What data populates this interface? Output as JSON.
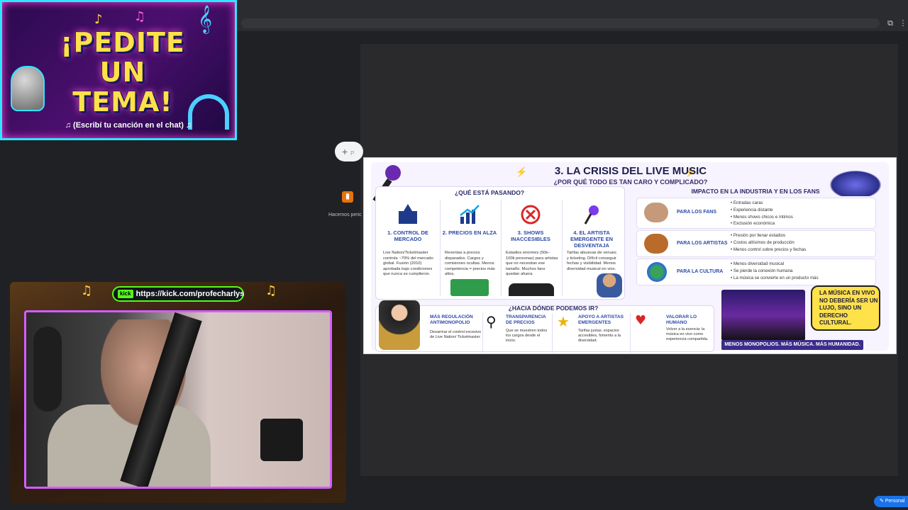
{
  "browser": {
    "extension_label": "Hacemos peric",
    "plus_button": "+",
    "plus_hint": "P",
    "bottom_pill": "Personal"
  },
  "overlay": {
    "title_line1": "¡PEDITE",
    "title_line2": "UN TEMA!",
    "subtitle": "♫ (Escribí tu canción en el chat) ♫"
  },
  "webcam": {
    "kick_logo": "kick",
    "kick_url": "https://kick.com/profecharlys"
  },
  "slide": {
    "title": "3. LA CRISIS DEL LIVE MUSIC",
    "subtitle": "¿POR QUÉ TODO ES TAN CARO Y COMPLICADO?",
    "left_heading": "¿QUÉ ESTÁ PASANDO?",
    "columns": [
      {
        "title": "1. CONTROL DE MERCADO",
        "text": "Live Nation/Ticketmaster controla ~70% del mercado global. Fusión (2010) aprobada bajo condiciones que nunca se cumplieron.",
        "icon": "building-icon"
      },
      {
        "title": "2. PRECIOS EN ALZA",
        "text": "Reventas a precios disparados. Cargos y comisiones ocultas. Menos competencia = precios más altos.",
        "icon": "chart-up-icon"
      },
      {
        "title": "3. SHOWS INACCESIBLES",
        "text": "Estadios enormes (50k–100k personas) para artistas que no necesitan ese tamaño. Muchos fans quedan afuera.",
        "icon": "x-circle-icon"
      },
      {
        "title": "4. EL ARTISTA EMERGENTE EN DESVENTAJA",
        "text": "Tarifas abusivas de venues y ticketing. Difícil conseguir fechas y visibilidad. Menos diversidad musical en vivo.",
        "icon": "microphone-icon"
      }
    ],
    "right_heading": "IMPACTO EN LA INDUSTRIA Y EN LOS FANS",
    "impacts": [
      {
        "label": "PARA LOS FANS",
        "items": [
          "Entradas caras",
          "Experiencia distante",
          "Menos shows chicos e íntimos",
          "Exclusión económica"
        ]
      },
      {
        "label": "PARA LOS ARTISTAS",
        "items": [
          "Presión por llenar estadios",
          "Costos altísimos de producción",
          "Menos control sobre precios y fechas"
        ]
      },
      {
        "label": "PARA LA CULTURA",
        "items": [
          "Menos diversidad musical",
          "Se pierde la conexión humana",
          "La música se convierte en un producto más"
        ]
      }
    ],
    "bottom_heading": "¿HACIA DÓNDE PODEMOS IR?",
    "solutions": [
      {
        "title": "MÁS REGULACIÓN ANTIMONOPOLIO",
        "text": "Desarmar el control excesivo de Live Nation/ Ticketmaster."
      },
      {
        "title": "TRANSPARENCIA DE PRECIOS",
        "text": "Que se muestren todos los cargos desde el inicio."
      },
      {
        "title": "APOYO A ARTISTAS EMERGENTES",
        "text": "Tarifas justas, espacios accesibles, fomento a la diversidad."
      },
      {
        "title": "VALORAR LO HUMANO",
        "text": "Volver a la esencia: la música en vivo como experiencia compartida."
      }
    ],
    "bubble": "LA MÚSICA EN VIVO NO DEBERÍA SER UN LUJO, SINO UN DERECHO CULTURAL.",
    "footer": "MENOS MONOPOLIOS. MÁS MÚSICA. MÁS HUMANIDAD."
  }
}
